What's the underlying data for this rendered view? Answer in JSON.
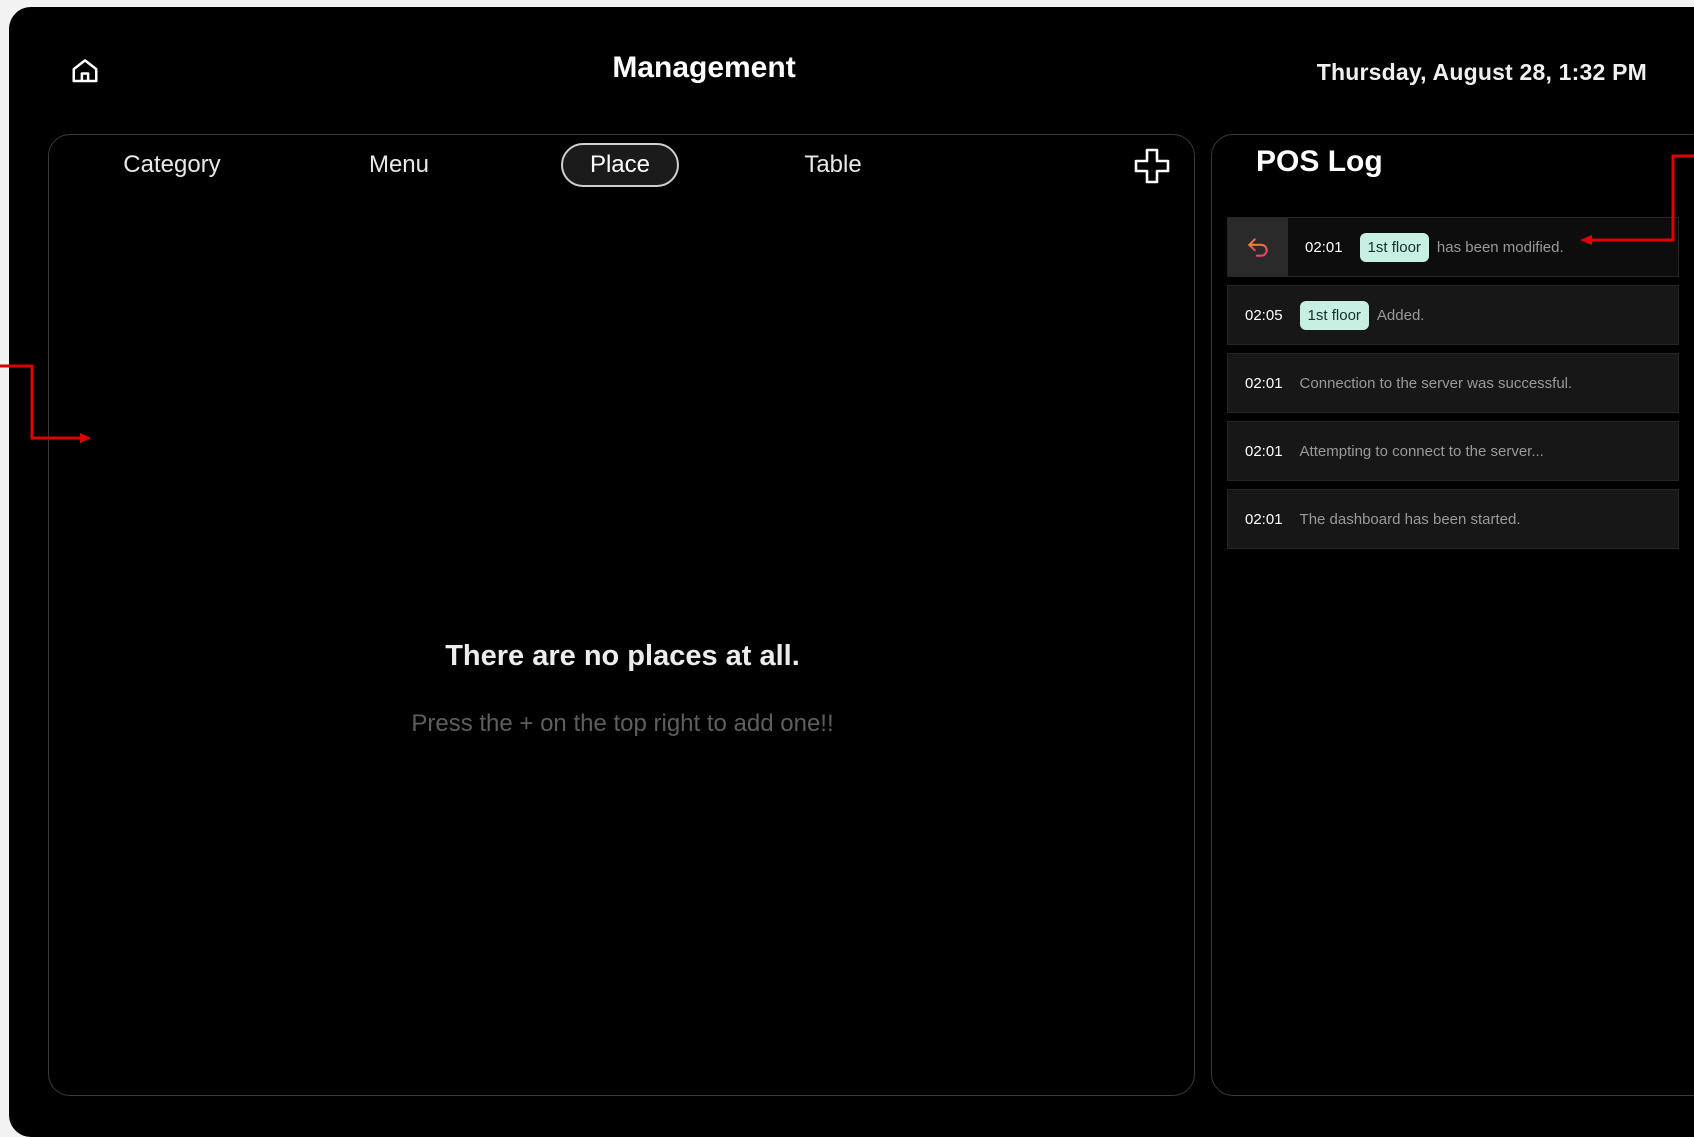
{
  "header": {
    "title": "Management",
    "datetime": "Thursday, August 28, 1:32 PM",
    "home_icon": "home-icon"
  },
  "tabs": [
    {
      "label": "Category",
      "active": false
    },
    {
      "label": "Menu",
      "active": false
    },
    {
      "label": "Place",
      "active": true
    },
    {
      "label": "Table",
      "active": false
    }
  ],
  "add_icon": "plus-icon",
  "empty_state": {
    "title": "There are no places at all.",
    "subtitle": "Press the + on the top right to add one!!"
  },
  "log": {
    "title": "POS Log",
    "entries": [
      {
        "time": "02:01",
        "badge": "1st floor",
        "message": "has been modified.",
        "undo": true
      },
      {
        "time": "02:05",
        "badge": "1st floor",
        "message": "Added.",
        "undo": false
      },
      {
        "time": "02:01",
        "badge": "",
        "message": "Connection to the server was successful.",
        "undo": false
      },
      {
        "time": "02:01",
        "badge": "",
        "message": "Attempting to connect to the server...",
        "undo": false
      },
      {
        "time": "02:01",
        "badge": "",
        "message": "The dashboard has been started.",
        "undo": false
      }
    ]
  },
  "colors": {
    "background": "#000000",
    "badge_bg": "#c8efe3",
    "annotation_arrow": "#e00000",
    "undo_icon_gradient": [
      "#f08a2c",
      "#e23a6a"
    ]
  }
}
